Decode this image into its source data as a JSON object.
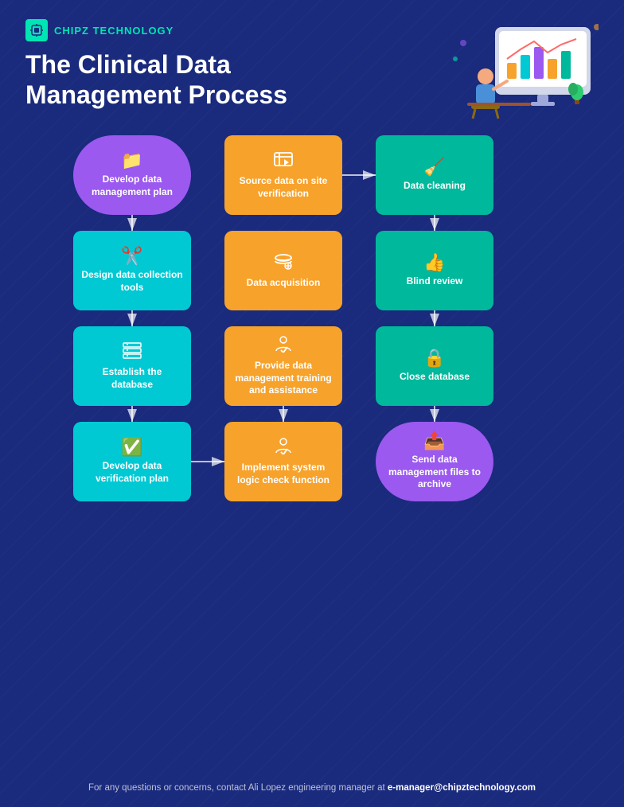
{
  "brand": {
    "name": "CHIPZ TECHNOLOGY"
  },
  "title": {
    "line1": "The Clinical Data",
    "line2": "Management Process"
  },
  "nodes": [
    {
      "id": "develop-plan",
      "label": "Develop data management plan",
      "color": "purple",
      "col": 1,
      "row": 1
    },
    {
      "id": "source-data",
      "label": "Source data on site verification",
      "color": "orange",
      "col": 2,
      "row": 1
    },
    {
      "id": "data-cleaning",
      "label": "Data cleaning",
      "color": "teal",
      "col": 3,
      "row": 1
    },
    {
      "id": "design-tools",
      "label": "Design data collection tools",
      "color": "cyan",
      "col": 1,
      "row": 2
    },
    {
      "id": "data-acquisition",
      "label": "Data acquisition",
      "color": "orange",
      "col": 2,
      "row": 2
    },
    {
      "id": "blind-review",
      "label": "Blind review",
      "color": "teal",
      "col": 3,
      "row": 2
    },
    {
      "id": "establish-db",
      "label": "Establish the database",
      "color": "cyan",
      "col": 1,
      "row": 3
    },
    {
      "id": "provide-training",
      "label": "Provide data management training and assistance",
      "color": "orange",
      "col": 2,
      "row": 3
    },
    {
      "id": "close-db",
      "label": "Close database",
      "color": "teal",
      "col": 3,
      "row": 3
    },
    {
      "id": "develop-verif",
      "label": "Develop data verification plan",
      "color": "cyan",
      "col": 1,
      "row": 4
    },
    {
      "id": "implement-logic",
      "label": "Implement system logic check function",
      "color": "orange",
      "col": 2,
      "row": 4
    },
    {
      "id": "send-archive",
      "label": "Send data management files to archive",
      "color": "purple-bottom",
      "col": 3,
      "row": 4
    }
  ],
  "footer": {
    "text": "For any questions or concerns, contact Ali Lopez engineering manager at ",
    "email": "e-manager@chipztechnology.com"
  }
}
